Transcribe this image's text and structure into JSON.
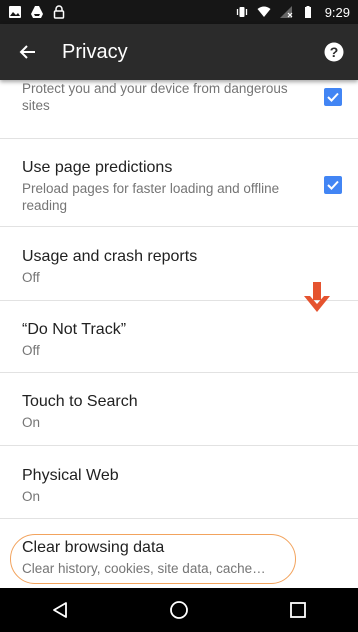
{
  "status_bar": {
    "time": "9:29",
    "icons": [
      "image-icon",
      "drive-icon",
      "lock-icon",
      "vibrate-icon",
      "wifi-icon",
      "no-signal-icon",
      "battery-icon"
    ]
  },
  "app_bar": {
    "title": "Privacy",
    "back_icon": "arrow-left-icon",
    "help_icon": "help-icon"
  },
  "settings": [
    {
      "title": "",
      "summary": "Protect you and your device from dangerous sites",
      "checked": true
    },
    {
      "title": "Use page predictions",
      "summary": "Preload pages for faster loading and offline reading",
      "checked": true
    },
    {
      "title": "Usage and crash reports",
      "summary": "Off"
    },
    {
      "title": "“Do Not Track”",
      "summary": "Off"
    },
    {
      "title": "Touch to Search",
      "summary": "On"
    },
    {
      "title": "Physical Web",
      "summary": "On"
    },
    {
      "title": "Clear browsing data",
      "summary": "Clear history, cookies, site data, cache…"
    }
  ],
  "annotation": {
    "arrow_color": "#e5532f",
    "highlight_color": "#f2a35d"
  },
  "nav_bar": {
    "buttons": [
      "back-icon",
      "home-icon",
      "recents-icon"
    ]
  },
  "colors": {
    "checkbox": "#4285f4",
    "app_bar": "#2b2b2b",
    "status_bar": "#161616"
  }
}
